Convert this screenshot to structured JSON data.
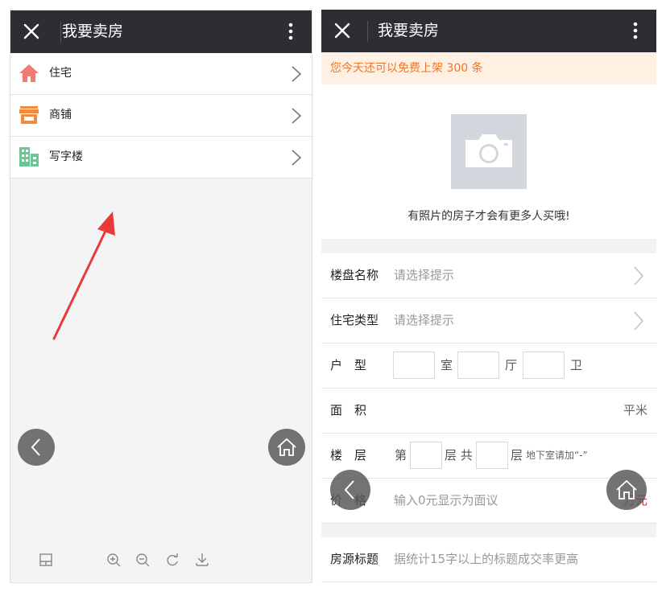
{
  "left": {
    "title": "我要卖房",
    "items": [
      {
        "label": "住宅",
        "icon": "house-icon",
        "color": "#f07a76"
      },
      {
        "label": "商铺",
        "icon": "storefront-icon",
        "color": "#f08a3e"
      },
      {
        "label": "写字楼",
        "icon": "office-building-icon",
        "color": "#6fc495"
      }
    ],
    "annotation_color": "#e8393b"
  },
  "right": {
    "title": "我要卖房",
    "notice": "您今天还可以免费上架 300 条",
    "photo_hint": "有照片的房子才会有更多人买哦!",
    "form": {
      "estate": {
        "label": "楼盘名称",
        "placeholder": "请选择提示"
      },
      "house_type": {
        "label": "住宅类型",
        "placeholder": "请选择提示"
      },
      "layout": {
        "label": "户　型",
        "room": "室",
        "hall": "厅",
        "bath": "卫"
      },
      "area": {
        "label": "面　积",
        "unit": "平米"
      },
      "floor": {
        "label": "楼　层",
        "prefix": "第",
        "mid": "层 共",
        "suffix": "层",
        "hint": "地下室请加“-”"
      },
      "price": {
        "label": "价　格",
        "placeholder": "输入0元显示为面议",
        "unit": "万元"
      },
      "listing_title": {
        "label": "房源标题",
        "placeholder": "据统计15字以上的标题成交率更高"
      }
    }
  },
  "colors": {
    "titlebar": "#2d2e33",
    "notice_bg": "#fff0e4",
    "notice_text": "#f0752b"
  }
}
